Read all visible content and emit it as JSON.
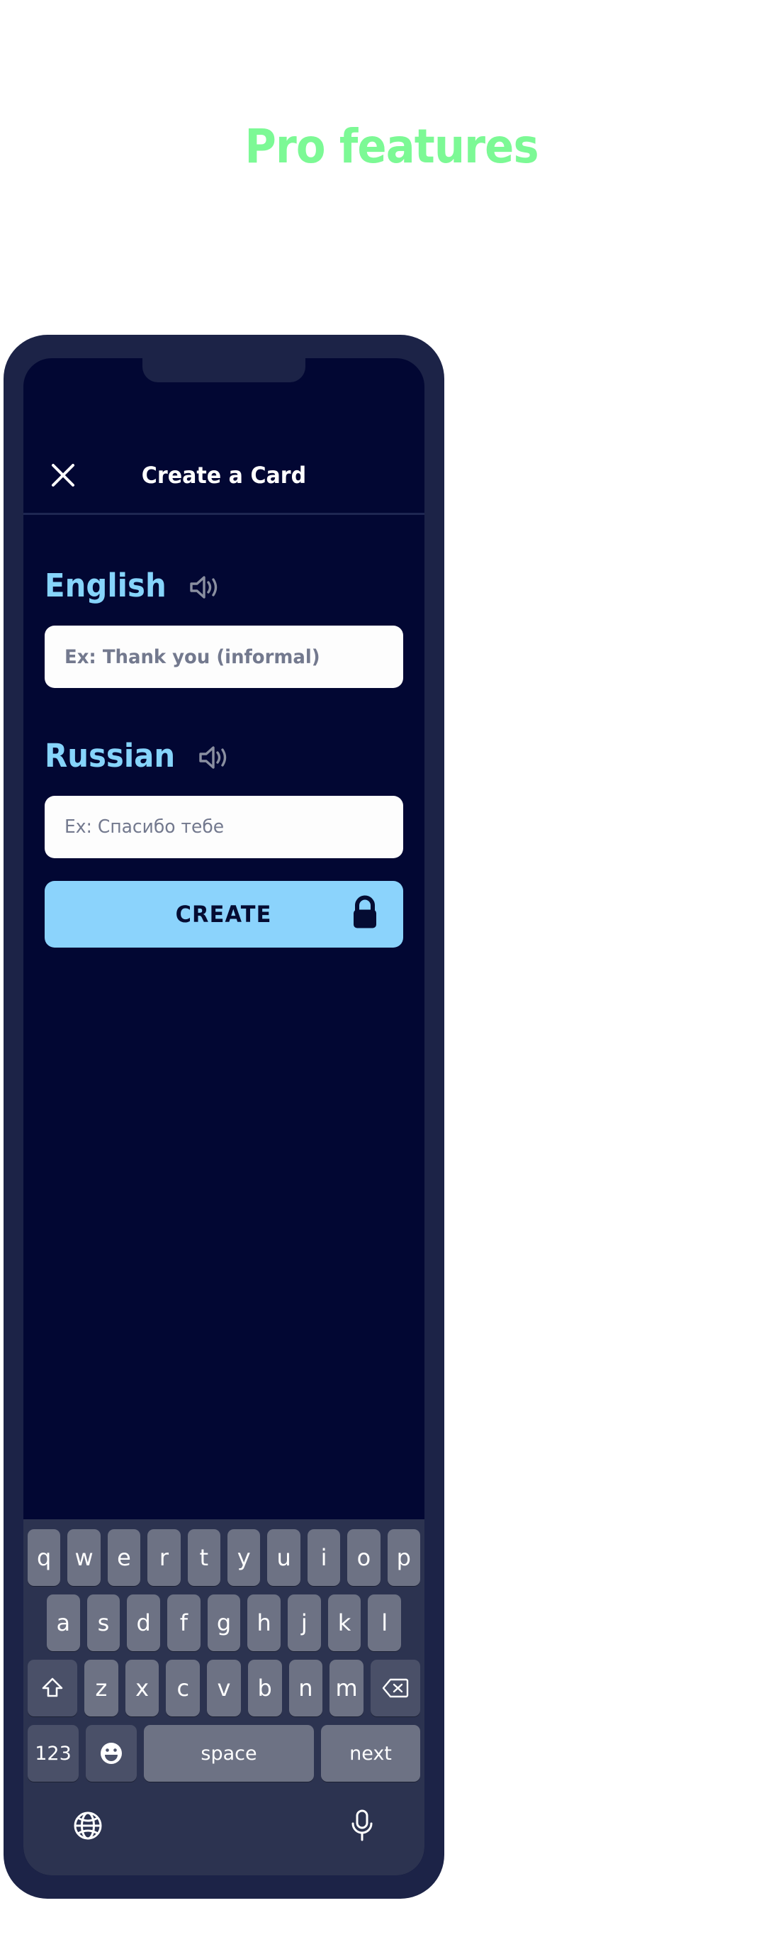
{
  "headline": "Pro features",
  "colors": {
    "accent_green": "#7CF995",
    "phone_frame": "#1c2347",
    "screen_bg": "#020733",
    "lang_blue": "#86D4FB",
    "button_blue": "#8BD3FC",
    "keyboard_bg": "#2c3350",
    "key_bg": "#6d7284",
    "key_dark": "#4a5068",
    "placeholder_gray": "#73798e"
  },
  "appbar": {
    "close_label": "✕",
    "title": "Create a Card"
  },
  "form": {
    "source": {
      "language": "English",
      "speaker_icon": "speaker-icon",
      "placeholder": "Ex: Thank you (informal)",
      "value": ""
    },
    "target": {
      "language": "Russian",
      "speaker_icon": "speaker-icon",
      "placeholder": "Ex: Спасибо тебе",
      "value": ""
    },
    "submit": {
      "label": "CREATE",
      "lock_icon": "lock-icon"
    }
  },
  "keyboard": {
    "row1": [
      "q",
      "w",
      "e",
      "r",
      "t",
      "y",
      "u",
      "i",
      "o",
      "p"
    ],
    "row2": [
      "a",
      "s",
      "d",
      "f",
      "g",
      "h",
      "j",
      "k",
      "l"
    ],
    "row3": [
      "z",
      "x",
      "c",
      "v",
      "b",
      "n",
      "m"
    ],
    "shift_label": "⇧",
    "backspace_label": "⌫",
    "num_label": "123",
    "emoji_label": "emoji-icon",
    "space_label": "space",
    "next_label": "next",
    "globe_label": "globe-icon",
    "mic_label": "microphone-icon"
  }
}
